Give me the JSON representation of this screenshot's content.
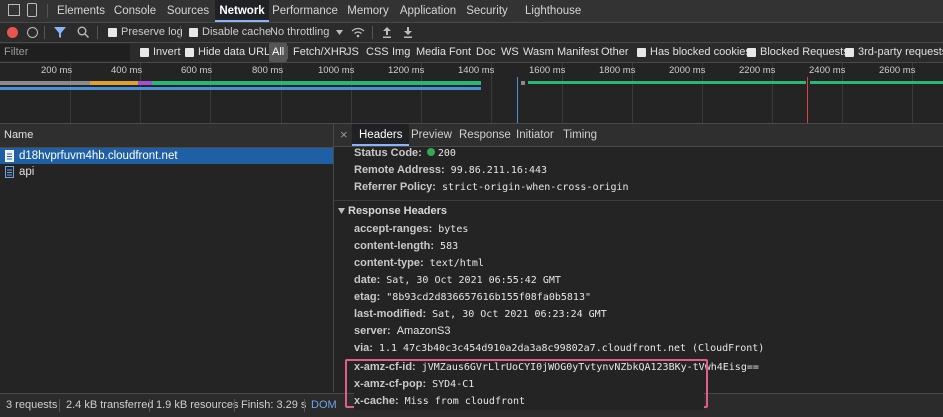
{
  "tabs": [
    "Elements",
    "Console",
    "Sources",
    "Network",
    "Performance",
    "Memory",
    "Application",
    "Security",
    "Lighthouse"
  ],
  "active_tab": "Network",
  "toolbar": {
    "preserve_log": "Preserve log",
    "disable_cache": "Disable cache",
    "throttling": "No throttling"
  },
  "filter": {
    "placeholder": "Filter",
    "invert": "Invert",
    "hide_data_urls": "Hide data URLs",
    "types": [
      "All",
      "Fetch/XHR",
      "JS",
      "CSS",
      "Img",
      "Media",
      "Font",
      "Doc",
      "WS",
      "Wasm",
      "Manifest",
      "Other"
    ],
    "has_blocked_cookies": "Has blocked cookies",
    "blocked_requests": "Blocked Requests",
    "third_party": "3rd-party requests"
  },
  "timeline": {
    "ticks": [
      "200 ms",
      "400 ms",
      "600 ms",
      "800 ms",
      "1000 ms",
      "1200 ms",
      "1400 ms",
      "1600 ms",
      "1800 ms",
      "2000 ms",
      "2200 ms",
      "2400 ms",
      "2600 ms"
    ]
  },
  "requests": {
    "header": "Name",
    "items": [
      "d18hvprfuvm4hb.cloudfront.net",
      "api"
    ]
  },
  "status_bar": {
    "requests": "3 requests",
    "transferred": "2.4 kB transferred",
    "resources": "1.9 kB resources",
    "finish": "Finish: 3.29 s",
    "dom": "DOM"
  },
  "detail_tabs": [
    "Headers",
    "Preview",
    "Response",
    "Initiator",
    "Timing"
  ],
  "active_detail_tab": "Headers",
  "general": [
    {
      "key": "Status Code:",
      "value": "200"
    },
    {
      "key": "Remote Address:",
      "value": "99.86.211.16:443"
    },
    {
      "key": "Referrer Policy:",
      "value": "strict-origin-when-cross-origin"
    }
  ],
  "response_headers_title": "Response Headers",
  "response_headers": [
    {
      "key": "accept-ranges:",
      "value": "bytes"
    },
    {
      "key": "content-length:",
      "value": "583"
    },
    {
      "key": "content-type:",
      "value": "text/html"
    },
    {
      "key": "date:",
      "value": "Sat, 30 Oct 2021 06:55:42 GMT"
    },
    {
      "key": "etag:",
      "value": "\"8b93cd2d836657616b155f08fa0b5813\""
    },
    {
      "key": "last-modified:",
      "value": "Sat, 30 Oct 2021 06:23:24 GMT"
    },
    {
      "key": "server:",
      "value": "AmazonS3"
    },
    {
      "key": "via:",
      "value": "1.1 47c3b40c3c454d910a2da3a8c99802a7.cloudfront.net (CloudFront)"
    },
    {
      "key": "x-amz-cf-id:",
      "value": "jVMZaus6GVrLlrUoCYI0jWOG0yTvtynvNZbkQA123BKy-tVwh4Eisg=="
    },
    {
      "key": "x-amz-cf-pop:",
      "value": "SYD4-C1"
    },
    {
      "key": "x-cache:",
      "value": "Miss from cloudfront"
    }
  ],
  "colors": {
    "status_ok": "#34a853",
    "highlight": "#e35c8c",
    "accent": "#8ab4f8"
  }
}
